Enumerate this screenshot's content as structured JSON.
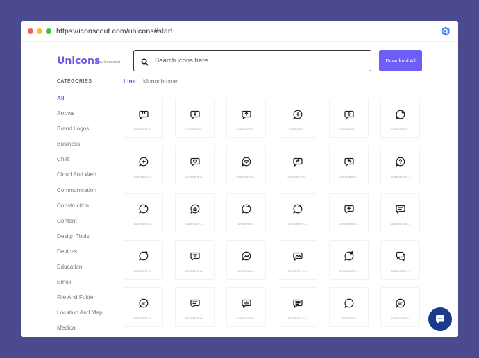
{
  "browser": {
    "url": "https://iconscout.com/unicons#start",
    "logo_icon": "browser-logo-icon"
  },
  "brand": {
    "name": "Unicons",
    "subtitle": "by Iconscout"
  },
  "search": {
    "placeholder": "Search icons here...",
    "value": ""
  },
  "download_all_label": "Download All",
  "categories": {
    "title": "CATEGORIES",
    "items": [
      "All",
      "Arrows",
      "Brand Logos",
      "Business",
      "Chat",
      "Cloud And Web",
      "Communication",
      "Construction",
      "Content",
      "Design Tools",
      "Devices",
      "Education",
      "Emoji",
      "File And Folder",
      "Location And Map",
      "Medical"
    ],
    "active": "All"
  },
  "tabs": [
    {
      "label": "Line",
      "active": true
    },
    {
      "label": "Monochrome",
      "active": false
    }
  ],
  "icons": [
    {
      "icon": "comment-lock-icon",
      "label": "comment-a..."
    },
    {
      "icon": "comment-alt-arrow-down-icon",
      "label": "comment-a..."
    },
    {
      "icon": "comment-alt-arrow-up-icon",
      "label": "comment-a..."
    },
    {
      "icon": "comment-plus-icon",
      "label": "comment-..."
    },
    {
      "icon": "comment-alt-plus-icon",
      "label": "comment-a..."
    },
    {
      "icon": "comment-dot-icon",
      "label": "comment-s..."
    },
    {
      "icon": "comment-add-icon",
      "label": "comment-p..."
    },
    {
      "icon": "comment-alt-heart-icon",
      "label": "comment-a..."
    },
    {
      "icon": "comment-heart-icon",
      "label": "comment-h..."
    },
    {
      "icon": "comment-alt-redo-icon",
      "label": "comment-a..."
    },
    {
      "icon": "comment-alt-undo-icon",
      "label": "comment-a..."
    },
    {
      "icon": "comment-question-icon",
      "label": "comment-s..."
    },
    {
      "icon": "comment-redo-icon",
      "label": "comment-q..."
    },
    {
      "icon": "comment-lock-alt-icon",
      "label": "comment-l..."
    },
    {
      "icon": "comment-refresh-icon",
      "label": "comment-r..."
    },
    {
      "icon": "comment-share-icon",
      "label": "comment-s..."
    },
    {
      "icon": "comment-alt-info-icon",
      "label": "comment-a..."
    },
    {
      "icon": "comment-alt-lines-icon",
      "label": "comment-a..."
    },
    {
      "icon": "comment-upload-icon",
      "label": "comment-s..."
    },
    {
      "icon": "comment-alt-download-icon",
      "label": "comment-a..."
    },
    {
      "icon": "comment-image-icon",
      "label": "comment-i..."
    },
    {
      "icon": "comment-alt-image-icon",
      "label": "comment-a..."
    },
    {
      "icon": "comment-edit-icon",
      "label": "comment-e..."
    },
    {
      "icon": "comments-icon",
      "label": "comments-..."
    },
    {
      "icon": "comment-notes-icon",
      "label": "comment-n..."
    },
    {
      "icon": "comment-alt-message-icon",
      "label": "comment-a..."
    },
    {
      "icon": "comment-chart-icon",
      "label": "comment-a..."
    },
    {
      "icon": "comment-alt-notes-icon",
      "label": "comment-a..."
    },
    {
      "icon": "comment-icon",
      "label": "comment"
    },
    {
      "icon": "comment-lines-icon",
      "label": "comment-li..."
    }
  ],
  "chat_widget": {
    "icon": "chat-bubble-icon"
  },
  "colors": {
    "background": "#4b4a8f",
    "accent": "#6c5ef6",
    "brand": "#6a5ae0",
    "chat_fab": "#1b3a8a"
  }
}
